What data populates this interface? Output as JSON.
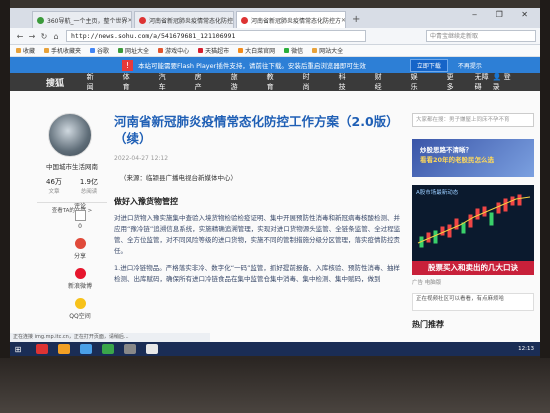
{
  "browser": {
    "tabs": [
      {
        "label": "360导航_一个主页，整个世界"
      },
      {
        "label": "河南省新冠肺炎疫情常态化防控"
      },
      {
        "label": "河南省新冠肺炎疫情常态化防控方"
      }
    ],
    "url": "http://news.sohu.com/a/541679681_121106991",
    "search_placeholder": "中青宝继续走新取",
    "bookmarks": [
      "收藏",
      "手机收藏夹",
      "谷歌",
      "网址大全",
      "游戏中心",
      "天猫超市",
      "大白菜官网",
      "微信",
      "网站大全"
    ]
  },
  "flash_notice": {
    "text": "本站可能需要Flash Player插件支持，请前往下载。安装后重启浏览器即可生效",
    "button": "立即下载",
    "link": "不再提示"
  },
  "sitenav": {
    "logo": "搜狐",
    "items": [
      "新闻",
      "体育",
      "汽车",
      "房产",
      "旅游",
      "教育",
      "时尚",
      "科技",
      "财经",
      "娱乐",
      "更多"
    ],
    "extra": "无障碍",
    "login": "登录"
  },
  "author": {
    "name": "中国城市生活网南",
    "articles_count": "46万",
    "articles_label": "文章",
    "views_count": "1.9亿",
    "views_label": "总阅读",
    "all_articles": "查看TA的文章 >"
  },
  "side_actions": [
    {
      "label": "评论",
      "count": "0"
    },
    {
      "label": "分享"
    },
    {
      "label": "新浪微博"
    },
    {
      "label": "QQ空间"
    }
  ],
  "article": {
    "title": "河南省新冠肺炎疫情常态化防控工作方案（2.0版）（续）",
    "date": "2022-04-27 12:12",
    "source": "（来源：临颍县广播电视台新媒体中心）",
    "section_heading": "做好入豫货物管控",
    "para1": "对进口货物入豫实施集中查验入境货物检验检疫证明、集中开展预防性消毒和新冠病毒核酸检测、并应用“豫冷链”追溯信息系统，实施精确追溯管理，实现对进口货物源头监管、全链条监管、全过程监管、全方位监管，对不同风险等级的进口货物，实施不同的管制措施分级分区管理，落实疫情防控责任。",
    "para2": "1.进口冷链物品。严格落实非冷、数字化“一码”监管，抓好提前报备、入库核验、预防性消毒、抽样检测、出库赋码，确保所有进口冷链食品在集中监管仓集中消毒、集中检测、集中赋码，做到"
  },
  "right": {
    "search_placeholder": "大家都在搜：男子嫌屋上同床不孕不育",
    "ad1_line1": "炒股思路不清晰？",
    "ad1_line2": "看看20年的老股民怎么选",
    "chart_title": "A股市场最新动态",
    "chart_banner": "股票买入和卖出的几大口诀",
    "ad_footer": "广告 电脑版",
    "rec_text": "正在视频社区可以看看，有点麻烦哈",
    "hot": "热门推荐"
  },
  "status_text": "正在连接 img.mp.itc.cn，正在打开页面，请稍后...",
  "taskbar": {
    "clock": "12:13"
  },
  "colors": {
    "title_blue": "#1f5fb5",
    "flash_bar": "#2d7fd6",
    "nav_dark": "#3a3a3a",
    "ad_red": "#c8203a"
  }
}
